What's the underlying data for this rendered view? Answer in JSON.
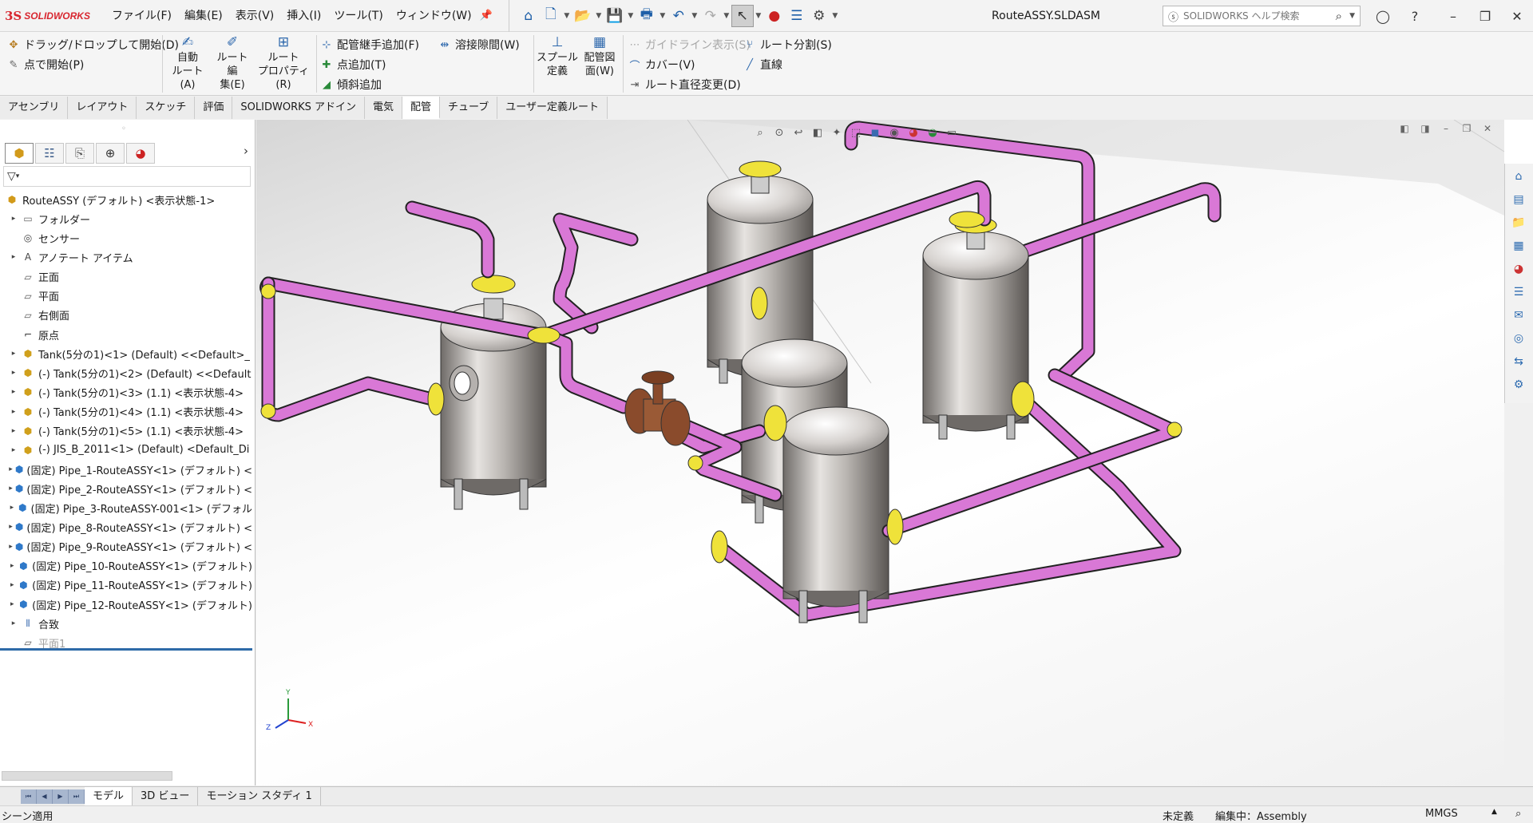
{
  "app": {
    "logo_mark": "3S",
    "logo_text": "SOLIDWORKS",
    "document_title": "RouteASSY.SLDASM"
  },
  "menu": {
    "items": [
      "ファイル(F)",
      "編集(E)",
      "表示(V)",
      "挿入(I)",
      "ツール(T)",
      "ウィンドウ(W)"
    ]
  },
  "help_search": {
    "placeholder": "SOLIDWORKS ヘルプ検索"
  },
  "command_manager": {
    "drag_drop_start": "ドラッグ/ドロップして開始(D)",
    "start_by_point": "点で開始(P)",
    "auto_route": [
      "自動",
      "ルート(A)"
    ],
    "edit_route": [
      "ルート編",
      "集(E)"
    ],
    "route_properties": [
      "ルート",
      "プロパティ(R)"
    ],
    "add_fitting": "配管継手追加(F)",
    "add_point": "点追加(T)",
    "add_slope": "傾斜追加",
    "weld_gap": "溶接隙間(W)",
    "spool_define": [
      "スプール",
      "定義"
    ],
    "piping_drawing": [
      "配管図",
      "面(W)"
    ],
    "show_guidelines": "ガイドライン表示(S)",
    "cover": "カバー(V)",
    "change_route_diameter": "ルート直径変更(D)",
    "split_route": "ルート分割(S)",
    "line": "直線"
  },
  "tabs": [
    "アセンブリ",
    "レイアウト",
    "スケッチ",
    "評価",
    "SOLIDWORKS アドイン",
    "電気",
    "配管",
    "チューブ",
    "ユーザー定義ルート"
  ],
  "active_tab": "配管",
  "feature_tree": {
    "items": [
      {
        "label": "RouteASSY (デフォルト) <表示状態-1>",
        "icon": "assembly-icon"
      },
      {
        "label": "フォルダー",
        "icon": "folder-icon"
      },
      {
        "label": "センサー",
        "icon": "sensor-icon"
      },
      {
        "label": "アノテート アイテム",
        "icon": "annotation-icon"
      },
      {
        "label": "正面",
        "icon": "plane-icon"
      },
      {
        "label": "平面",
        "icon": "plane-icon"
      },
      {
        "label": "右側面",
        "icon": "plane-icon"
      },
      {
        "label": "原点",
        "icon": "origin-icon"
      },
      {
        "label": "Tank(5分の1)<1> (Default) <<Default>_",
        "icon": "part-icon"
      },
      {
        "label": "(-) Tank(5分の1)<2> (Default) <<Default",
        "icon": "part-icon"
      },
      {
        "label": "(-) Tank(5分の1)<3> (1.1) <表示状態-4>",
        "icon": "part-icon"
      },
      {
        "label": "(-) Tank(5分の1)<4> (1.1) <表示状態-4>",
        "icon": "part-icon"
      },
      {
        "label": "(-) Tank(5分の1)<5> (1.1) <表示状態-4>",
        "icon": "part-icon"
      },
      {
        "label": "(-) JIS_B_2011<1> (Default) <Default_Di",
        "icon": "part-icon"
      },
      {
        "label": "(固定) Pipe_1-RouteASSY<1> (デフォルト) <",
        "icon": "route-assembly-icon"
      },
      {
        "label": "(固定) Pipe_2-RouteASSY<1> (デフォルト) <",
        "icon": "route-assembly-icon"
      },
      {
        "label": "(固定) Pipe_3-RouteASSY-001<1> (デフォル",
        "icon": "route-assembly-icon"
      },
      {
        "label": "(固定) Pipe_8-RouteASSY<1> (デフォルト) <",
        "icon": "route-assembly-icon"
      },
      {
        "label": "(固定) Pipe_9-RouteASSY<1> (デフォルト) <",
        "icon": "route-assembly-icon"
      },
      {
        "label": "(固定) Pipe_10-RouteASSY<1> (デフォルト)",
        "icon": "route-assembly-icon"
      },
      {
        "label": "(固定) Pipe_11-RouteASSY<1> (デフォルト)",
        "icon": "route-assembly-icon"
      },
      {
        "label": "(固定) Pipe_12-RouteASSY<1> (デフォルト)",
        "icon": "route-assembly-icon"
      },
      {
        "label": "合致",
        "icon": "mates-icon"
      },
      {
        "label": "平面1",
        "icon": "plane-icon"
      }
    ]
  },
  "triad": {
    "x": "X",
    "y": "Y",
    "z": "Z"
  },
  "bottom_tabs": [
    "モデル",
    "3D ビュー",
    "モーション スタディ 1"
  ],
  "status_bar": {
    "left": "シーン適用",
    "definition": "未定義",
    "editing": "編集中：Assembly",
    "units": "MMGS"
  },
  "colors": {
    "pipe": "#d978d6",
    "fitting": "#efe23a",
    "tank": "#c9c6c3",
    "valve": "#8a4b2c",
    "accent": "#2e6aa8"
  }
}
